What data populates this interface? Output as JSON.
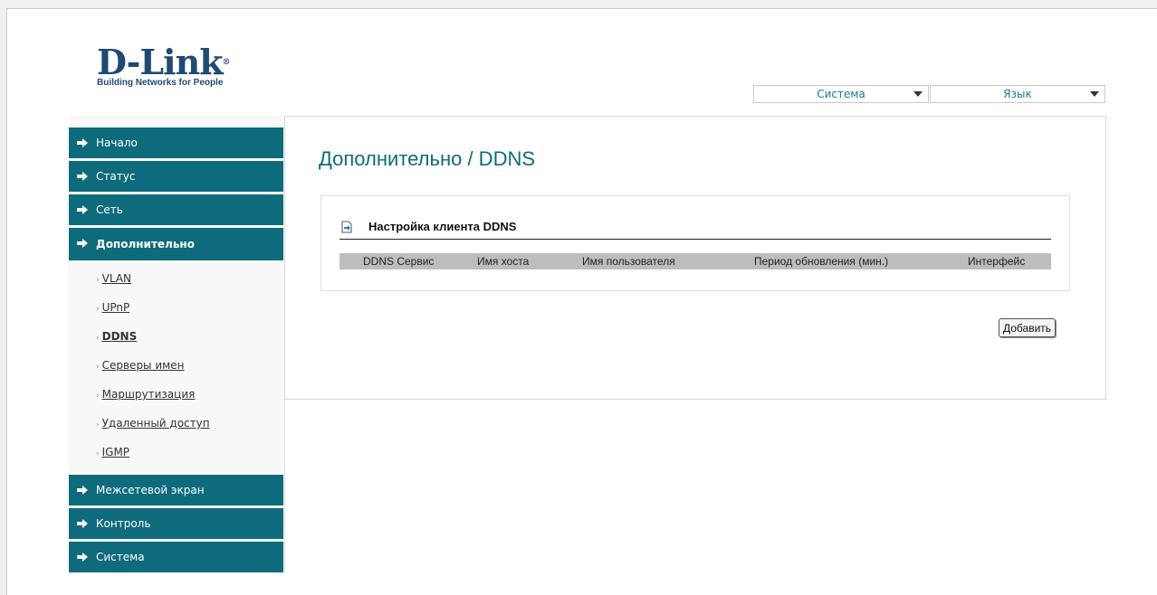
{
  "logo": {
    "name": "D-Link",
    "tagline": "Building Networks for People"
  },
  "header": {
    "system_menu": "Система",
    "language_menu": "Язык"
  },
  "sidebar": {
    "nav": [
      {
        "label": "Начало"
      },
      {
        "label": "Статус"
      },
      {
        "label": "Сеть"
      },
      {
        "label": "Дополнительно"
      },
      {
        "label": "Межсетевой экран"
      },
      {
        "label": "Контроль"
      },
      {
        "label": "Система"
      }
    ],
    "sub": [
      {
        "label": "VLAN"
      },
      {
        "label": "UPnP"
      },
      {
        "label": "DDNS"
      },
      {
        "label": "Серверы имен"
      },
      {
        "label": "Маршрутизация"
      },
      {
        "label": "Удаленный доступ"
      },
      {
        "label": "IGMP"
      }
    ]
  },
  "main": {
    "title": "Дополнительно /  DDNS",
    "section_title": "Настройка клиента DDNS",
    "table": {
      "columns": [
        "DDNS Сервис",
        "Имя хоста",
        "Имя пользователя",
        "Период обновления (мин.)",
        "Интерфейс"
      ],
      "rows": []
    },
    "add_button": "Добавить"
  },
  "colors": {
    "nav_bg": "#0e6b7c",
    "title": "#0e6b7c",
    "table_header": "#bdbdbd"
  }
}
